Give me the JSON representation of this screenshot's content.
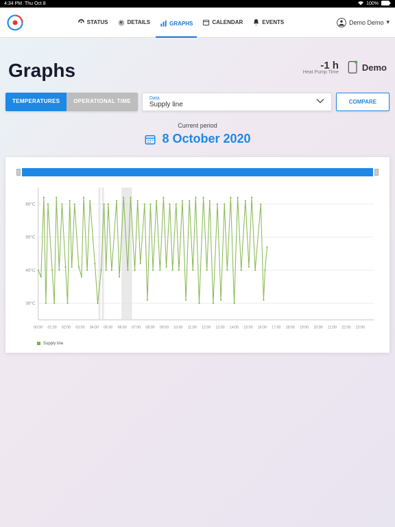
{
  "status_bar": {
    "time": "4:34 PM",
    "date": "Thu Oct 8",
    "battery": "100%"
  },
  "nav": {
    "items": [
      {
        "label": "STATUS"
      },
      {
        "label": "DETAILS"
      },
      {
        "label": "GRAPHS"
      },
      {
        "label": "CALENDAR"
      },
      {
        "label": "EVENTS"
      }
    ],
    "user": "Demo Demo"
  },
  "page": {
    "title": "Graphs"
  },
  "heat": {
    "hours": "-1 h",
    "label": "Heat Pump Time",
    "device": "Demo"
  },
  "tabs": {
    "temperatures": "TEMPERATURES",
    "operational": "OPERATIONAL TIME"
  },
  "data_select": {
    "label": "Data",
    "value": "Supply line"
  },
  "compare": "COMPARE",
  "period": {
    "label": "Current period",
    "date": "8 October 2020"
  },
  "legend": {
    "series": "Supply line"
  },
  "chart_data": {
    "type": "line",
    "title": "Supply line",
    "xlabel": "",
    "ylabel": "",
    "ylim": [
      25,
      65
    ],
    "y_ticks": [
      "30°C",
      "40°C",
      "50°C",
      "60°C"
    ],
    "x_ticks": [
      "00:00",
      "01:00",
      "02:00",
      "03:00",
      "04:00",
      "05:00",
      "06:00",
      "07:00",
      "08:00",
      "09:00",
      "10:00",
      "11:00",
      "12:00",
      "13:00",
      "14:00",
      "15:00",
      "16:00",
      "17:00",
      "18:00",
      "19:00",
      "20:00",
      "21:00",
      "22:00",
      "23:00"
    ],
    "series": [
      {
        "name": "Supply line",
        "x": [
          0,
          0.2,
          0.4,
          0.55,
          0.7,
          1.0,
          1.15,
          1.3,
          1.5,
          1.7,
          1.95,
          2.1,
          2.25,
          2.4,
          2.6,
          2.9,
          3.1,
          3.25,
          3.5,
          3.7,
          4.05,
          4.25,
          4.5,
          4.7,
          4.85,
          5.0,
          5.25,
          5.6,
          5.8,
          6.1,
          6.4,
          6.6,
          6.9,
          7.1,
          7.3,
          7.6,
          7.8,
          8.02,
          8.2,
          8.45,
          8.7,
          8.95,
          9.15,
          9.4,
          9.6,
          9.85,
          10.05,
          10.3,
          10.55,
          10.8,
          11.05,
          11.25,
          11.5,
          11.8,
          12.05,
          12.25,
          12.5,
          12.8,
          13.05,
          13.3,
          13.5,
          13.75,
          14.0,
          14.25,
          14.5,
          14.8,
          15.05,
          15.25,
          15.5,
          15.9,
          16.1,
          16.2,
          16.35
        ],
        "y": [
          40,
          38,
          62,
          30,
          60,
          40,
          30,
          62,
          40,
          60,
          41,
          30,
          61,
          41,
          60,
          41,
          38,
          62,
          40,
          61,
          42,
          30,
          40,
          60,
          40,
          60,
          40,
          61,
          38,
          62,
          40,
          62,
          40,
          61,
          42,
          60,
          31,
          60,
          40,
          61,
          40,
          62,
          41,
          60,
          40,
          60,
          40,
          61,
          31,
          61,
          40,
          62,
          30,
          62,
          40,
          61,
          30,
          60,
          31,
          60,
          40,
          62,
          30,
          62,
          40,
          61,
          41,
          62,
          40,
          60,
          31,
          40,
          47
        ]
      }
    ]
  }
}
